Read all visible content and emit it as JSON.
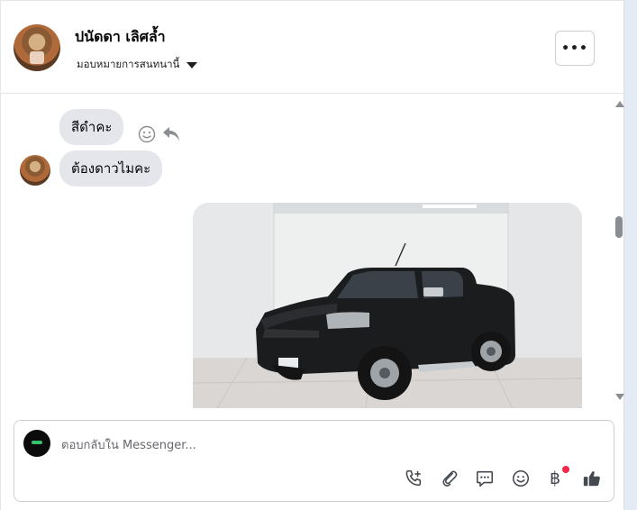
{
  "header": {
    "contact_name": "ปนัดดา เลิศล้ำ",
    "assign_label": "มอบหมายการสนทนานี้",
    "more_label": "•••"
  },
  "thread": {
    "messages": [
      {
        "text": "สีดำคะ"
      },
      {
        "text": "ต้องดาวไมคะ"
      }
    ],
    "photo_alt": "Black pickup truck in a white showroom"
  },
  "composer": {
    "placeholder": "ตอบกลับใน Messenger...",
    "currency_symbol": "฿"
  },
  "colors": {
    "bubble_bg": "#e4e6eb",
    "notification_dot": "#f02849",
    "icon": "#444950"
  },
  "icons": [
    "chevron-down-icon",
    "more-icon",
    "emoji-react-icon",
    "reply-icon",
    "phone-add-icon",
    "attachment-icon",
    "quick-reply-icon",
    "emoji-icon",
    "baht-icon",
    "thumbs-up-icon"
  ]
}
